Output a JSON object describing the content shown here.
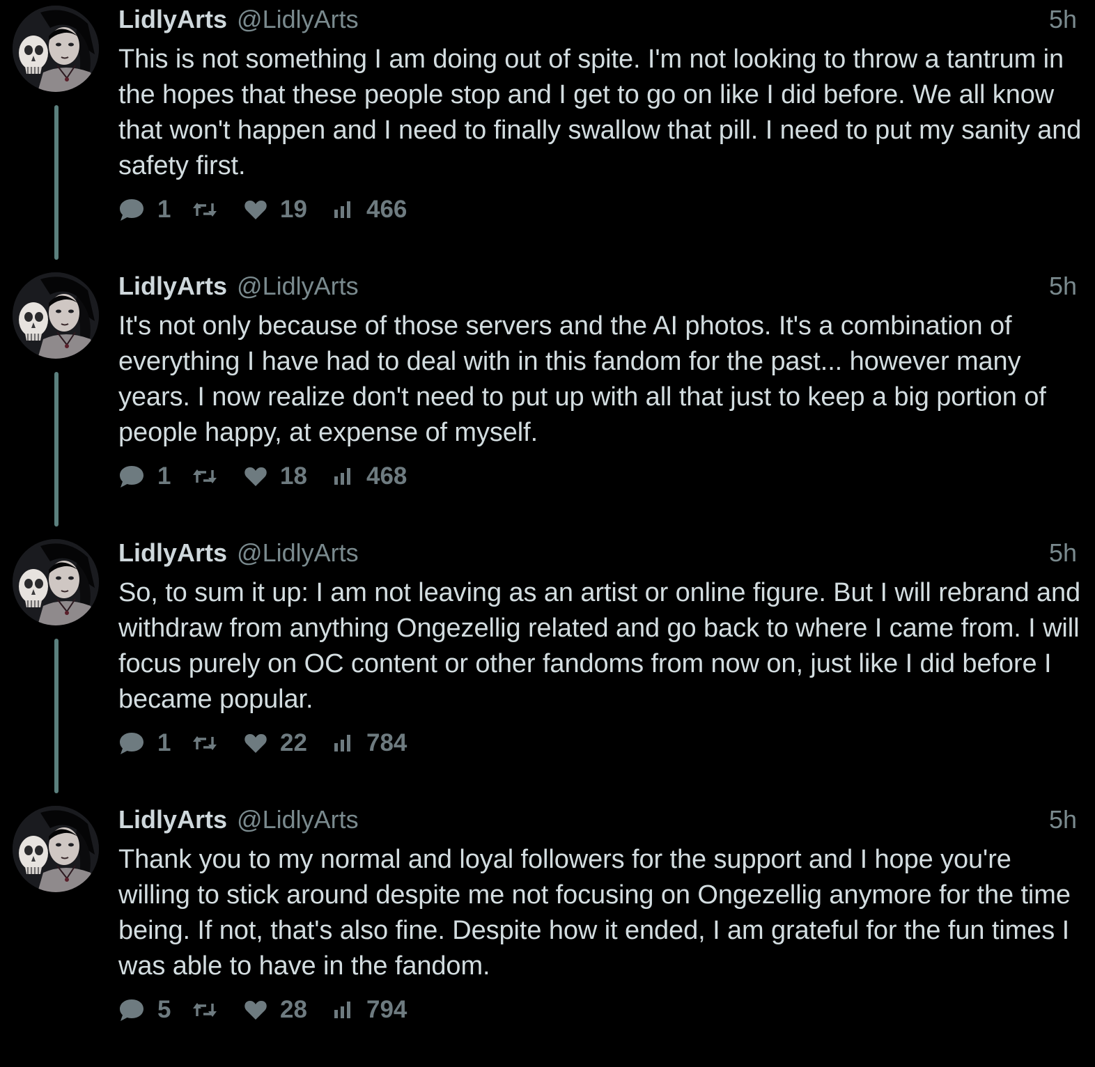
{
  "tweets": [
    {
      "name": "LidlyArts",
      "handle": "@LidlyArts",
      "time": "5h",
      "text": "This is not something I am doing out of spite. I'm not looking to throw a tantrum in the hopes that these people stop and I get to go on like I did before. We all know that won't happen and I need to finally swallow that pill. I need to put my sanity and safety first.",
      "replies": "1",
      "likes": "19",
      "views": "466"
    },
    {
      "name": "LidlyArts",
      "handle": "@LidlyArts",
      "time": "5h",
      "text": "It's not only because of those servers and the AI photos. It's a combination of everything I have had to deal with in this fandom for the past... however many years. I now realize don't need to put up with all that just to keep a big portion of people happy, at expense of myself.",
      "replies": "1",
      "likes": "18",
      "views": "468"
    },
    {
      "name": "LidlyArts",
      "handle": "@LidlyArts",
      "time": "5h",
      "text": "So, to sum it up: I am not leaving as an artist or online figure. But I will rebrand and withdraw from anything Ongezellig related and go back to where I came from. I will focus purely on OC content or other fandoms from now on, just like I did before I became popular.",
      "replies": "1",
      "likes": "22",
      "views": "784"
    },
    {
      "name": "LidlyArts",
      "handle": "@LidlyArts",
      "time": "5h",
      "text": "Thank you to my normal and loyal followers for the support and I hope you're willing to stick around despite me not focusing on Ongezellig anymore for the time being. If not, that's also fine. Despite how it ended, I am grateful for the fun times I was able to have in the fandom.",
      "replies": "5",
      "likes": "28",
      "views": "794"
    }
  ],
  "icons": {
    "reply": "reply-bubble-icon",
    "retweet": "retweet-arrows-icon",
    "like": "heart-icon",
    "views": "bar-chart-icon",
    "avatar": "profile-avatar-skull-portrait"
  },
  "colors": {
    "background": "#000000",
    "text": "#d3dde0",
    "muted": "#7a8a8e",
    "icon": "#6e7b80",
    "thread_line": "#5b807e"
  }
}
